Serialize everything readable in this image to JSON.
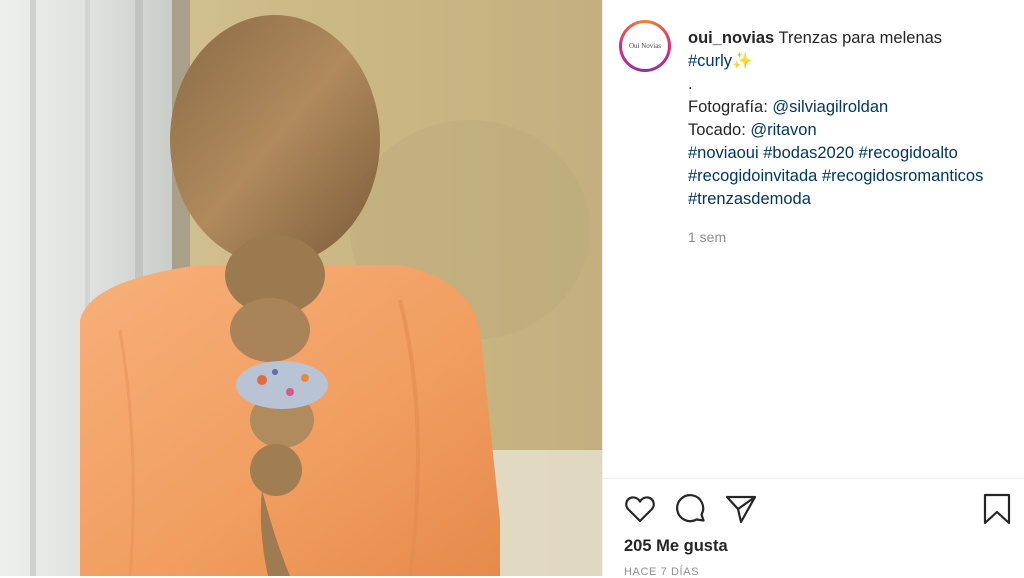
{
  "post": {
    "username": "oui_novias",
    "avatar_logo_text": "Oui Novias",
    "caption_title": "Trenzas para melenas",
    "caption_tag_curly": "#curly",
    "sparkle": "✨",
    "dot": ".",
    "photo_label": "Fotografía:",
    "photo_credit": "@silviagilroldan",
    "headpiece_label": "Tocado:",
    "headpiece_credit": "@ritavon",
    "hashtags": {
      "novia": "#noviaoui",
      "bodas": "#bodas2020",
      "recogidoalto": "#recogidoalto",
      "recogidoinvitada": "#recogidoinvitada",
      "romanticos": "#recogidosromanticos",
      "trenzas": "#trenzasdemoda"
    },
    "time_ago": "1 sem",
    "likes": "205 Me gusta",
    "date": "HACE 7 DÍAS"
  },
  "icons": {
    "like": "heart-icon",
    "comment": "comment-icon",
    "share": "paper-plane-icon",
    "save": "bookmark-icon"
  },
  "colors": {
    "text": "#262626",
    "link": "#00376b",
    "muted": "#8e8e8e",
    "divider": "#efefef",
    "dress": "#f2a266"
  }
}
